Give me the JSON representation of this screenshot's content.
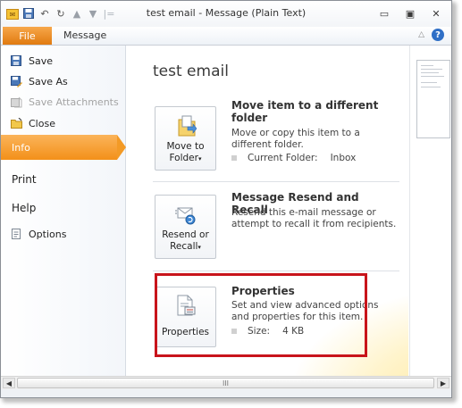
{
  "window": {
    "title": "test email  -  Message (Plain Text)",
    "controls": {
      "minimize": "▭",
      "maximize": "▣",
      "close": "✕"
    }
  },
  "quick_access": {
    "icons": [
      "mail-icon",
      "save-icon",
      "undo-icon",
      "redo-icon",
      "up-arrow-icon",
      "down-arrow-icon"
    ],
    "separator": "|="
  },
  "ribbon": {
    "tabs": [
      {
        "label": "File",
        "active": true
      },
      {
        "label": "Message",
        "active": false
      }
    ],
    "collapse_glyph": "△",
    "help_glyph": "?"
  },
  "backstage": {
    "menu": [
      {
        "label": "Save",
        "icon": "save-icon",
        "enabled": true
      },
      {
        "label": "Save As",
        "icon": "save-as-icon",
        "enabled": true
      },
      {
        "label": "Save Attachments",
        "icon": "attachments-icon",
        "enabled": false
      },
      {
        "label": "Close",
        "icon": "close-folder-icon",
        "enabled": true
      },
      {
        "label": "Info",
        "selected": true
      },
      {
        "label": "Print"
      },
      {
        "label": "Help"
      },
      {
        "label": "Options",
        "icon": "options-icon"
      }
    ],
    "page_title": "test email",
    "sections": [
      {
        "button_label_line1": "Move to",
        "button_label_line2": "Folder",
        "title": "Move item to a different folder",
        "description": "Move or copy this item to a different folder.",
        "meta_label": "Current Folder:",
        "meta_value": "Inbox"
      },
      {
        "button_label_line1": "Resend or",
        "button_label_line2": "Recall",
        "title": "Message Resend and Recall",
        "description": "Resend this e-mail message or attempt to recall it from recipients."
      },
      {
        "button_label_line1": "Properties",
        "title": "Properties",
        "description": "Set and view advanced options and properties for this item.",
        "meta_label": "Size:",
        "meta_value": "4 KB",
        "highlighted": true
      }
    ]
  },
  "scrollbar": {
    "thumb_glyph": "III",
    "left_glyph": "◀",
    "right_glyph": "▶"
  },
  "colors": {
    "file_tab": "#e87f15",
    "info_selected": "#f39019",
    "highlight_border": "#c8141b",
    "help_button": "#2f6fc6"
  }
}
